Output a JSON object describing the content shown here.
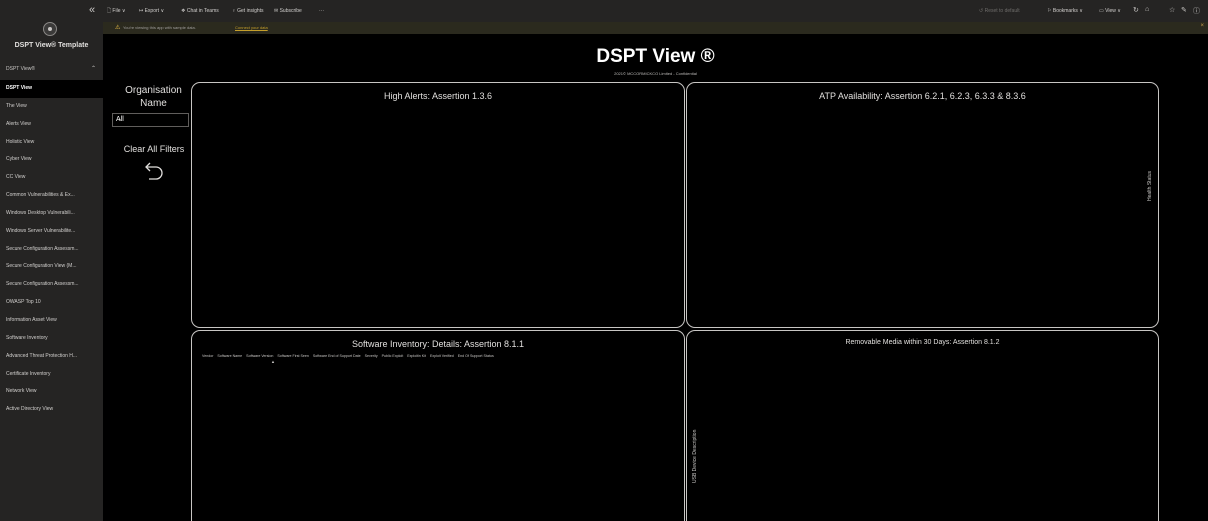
{
  "sidebar": {
    "collapse_icon": "double-chevron-left-icon",
    "app_title": "DSPT View® Template",
    "section_label": "DSPT View®",
    "items": [
      {
        "label": "DSPT View",
        "active": true
      },
      {
        "label": "The View"
      },
      {
        "label": "Alerts View"
      },
      {
        "label": "Holistic View"
      },
      {
        "label": "Cyber View"
      },
      {
        "label": "CC View"
      },
      {
        "label": "Common Vulnerabilities & Ex..."
      },
      {
        "label": "Windows Desktop Vulnerabili..."
      },
      {
        "label": "Windows Server Vulnerabilite..."
      },
      {
        "label": "Secure Configuration Assessm..."
      },
      {
        "label": "Secure Configuration View (M..."
      },
      {
        "label": "Secure Configuration Assessm..."
      },
      {
        "label": "OWASP Top 10"
      },
      {
        "label": "Information Asset View"
      },
      {
        "label": "Software Inventory"
      },
      {
        "label": "Advanced Threat Protection H..."
      },
      {
        "label": "Certificate Inventory"
      },
      {
        "label": "Network View"
      },
      {
        "label": "Active Directory View"
      }
    ]
  },
  "topbar": {
    "file": "File",
    "export": "Export",
    "chat": "Chat in Teams",
    "insights": "Get insights",
    "subscribe": "Subscribe",
    "more": "···",
    "reset": "Reset to default",
    "bookmarks": "Bookmarks",
    "view": "View"
  },
  "banner": {
    "message": "You're viewing this app with sample data.",
    "link": "Connect your data"
  },
  "report": {
    "title": "DSPT View ®",
    "subtitle": "2021© MCCORMICKCO Limited - Confidential"
  },
  "slicer": {
    "label": "Organisation Name",
    "value": "All",
    "clear_label": "Clear All Filters"
  },
  "cards": {
    "high_alerts": {
      "title": "High Alerts: Assertion 1.3.6"
    },
    "atp": {
      "title": "ATP Availability: Assertion 6.2.1, 6.2.3, 6.3.3 & 8.3.6",
      "axis_label": "Health Status"
    },
    "software": {
      "title": "Software Inventory: Details: Assertion 8.1.1",
      "columns": [
        "Vendor",
        "Software Name",
        "Software Version",
        "Software First Seen",
        "Software End of Support Date",
        "Severity",
        "Public Exploit",
        "Exploitin Kit",
        "Exploit Verified",
        "End Of Support Status"
      ]
    },
    "removable": {
      "title": "Removable Media within 30 Days: Assertion 8.1.2",
      "axis_label": "USB Device Description"
    }
  },
  "colors": {
    "background": "#000000",
    "sidebar": "#252423",
    "banner": "#2b2a1e",
    "warning": "#f7c84b",
    "card_border": "#c8c6c4"
  }
}
